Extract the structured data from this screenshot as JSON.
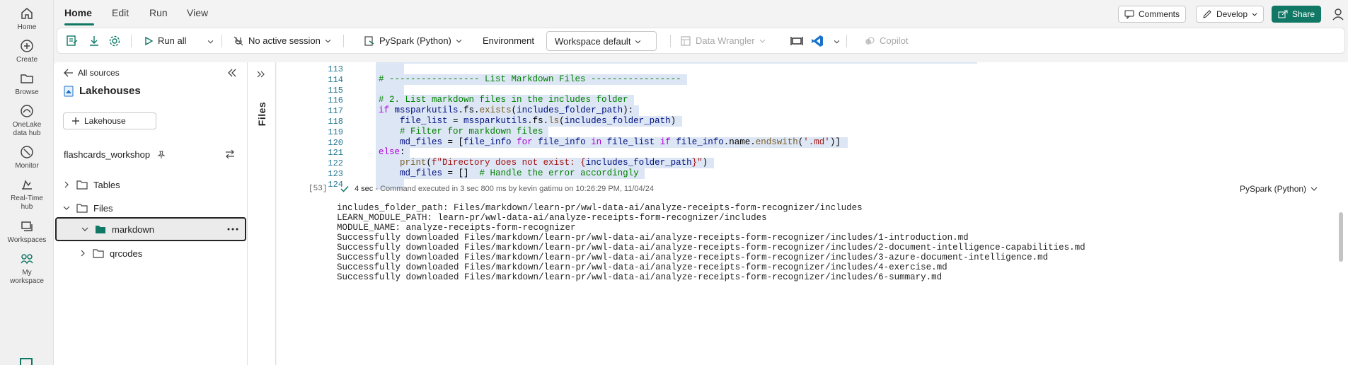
{
  "rail": [
    {
      "label": "Home",
      "icon": "home-icon"
    },
    {
      "label": "Create",
      "icon": "plus-circle-icon"
    },
    {
      "label": "Browse",
      "icon": "folder-icon"
    },
    {
      "label": "OneLake data hub",
      "icon": "onelake-icon"
    },
    {
      "label": "Monitor",
      "icon": "monitor-icon"
    },
    {
      "label": "Real-Time hub",
      "icon": "realtime-icon"
    },
    {
      "label": "Workspaces",
      "icon": "workspaces-icon"
    },
    {
      "label": "My workspace",
      "icon": "my-workspace-icon"
    }
  ],
  "menu": {
    "tabs": [
      "Home",
      "Edit",
      "Run",
      "View"
    ],
    "comments": "Comments",
    "develop": "Develop",
    "share": "Share"
  },
  "toolbar": {
    "run_all": "Run all",
    "session": "No active session",
    "language": "PySpark (Python)",
    "environment": "Environment",
    "workspace": "Workspace default",
    "data_wrangler": "Data Wrangler",
    "copilot": "Copilot"
  },
  "explorer": {
    "all_sources": "All sources",
    "section": "Lakehouses",
    "add": "Lakehouse",
    "lakehouse": "flashcards_workshop",
    "tables": "Tables",
    "files": "Files",
    "markdown": "markdown",
    "qrcodes": "qrcodes",
    "panel_label": "Files"
  },
  "code": {
    "line_numbers": [
      "113",
      "114",
      "115",
      "116",
      "117",
      "118",
      "119",
      "120",
      "121",
      "122",
      "123",
      "124"
    ],
    "lines": [
      "",
      "# ----------------- List Markdown Files -----------------",
      "",
      "# 2. List markdown files in the includes folder",
      "if mssparkutils.fs.exists(includes_folder_path):",
      "    file_list = mssparkutils.fs.ls(includes_folder_path)",
      "    # Filter for markdown files",
      "    md_files = [file_info for file_info in file_list if file_info.name.endswith('.md')]",
      "else:",
      "    print(f\"Directory does not exist: {includes_folder_path}\")",
      "    md_files = []  # Handle the error accordingly",
      ""
    ]
  },
  "exec": {
    "count": "[53]",
    "duration": "4 sec",
    "message": "- Command executed in 3 sec 800 ms by kevin gatimu on 10:26:29 PM, 11/04/24",
    "language": "PySpark (Python)"
  },
  "output": [
    "includes_folder_path: Files/markdown/learn-pr/wwl-data-ai/analyze-receipts-form-recognizer/includes",
    "LEARN_MODULE_PATH: learn-pr/wwl-data-ai/analyze-receipts-form-recognizer/includes",
    "MODULE_NAME: analyze-receipts-form-recognizer",
    "Successfully downloaded Files/markdown/learn-pr/wwl-data-ai/analyze-receipts-form-recognizer/includes/1-introduction.md",
    "Successfully downloaded Files/markdown/learn-pr/wwl-data-ai/analyze-receipts-form-recognizer/includes/2-document-intelligence-capabilities.md",
    "Successfully downloaded Files/markdown/learn-pr/wwl-data-ai/analyze-receipts-form-recognizer/includes/3-azure-document-intelligence.md",
    "Successfully downloaded Files/markdown/learn-pr/wwl-data-ai/analyze-receipts-form-recognizer/includes/4-exercise.md",
    "Successfully downloaded Files/markdown/learn-pr/wwl-data-ai/analyze-receipts-form-recognizer/includes/6-summary.md"
  ],
  "colors": {
    "accent": "#117865",
    "selection": "#dde6f4"
  }
}
